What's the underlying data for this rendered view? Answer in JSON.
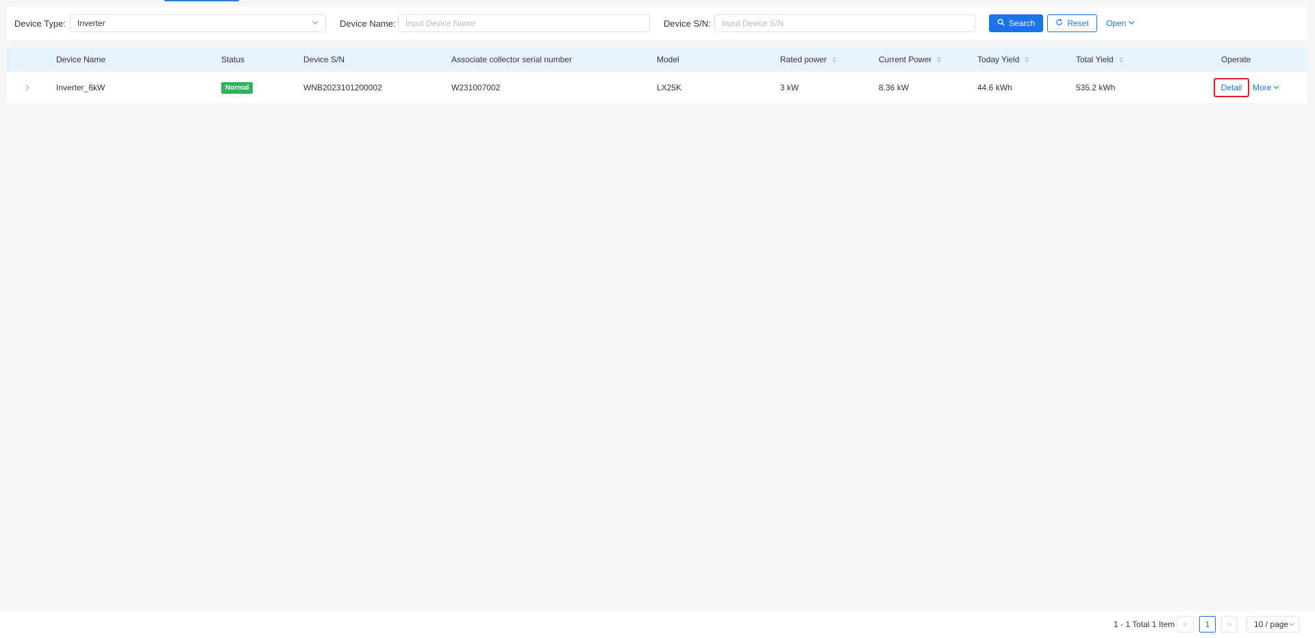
{
  "filters": {
    "device_type_label": "Device Type:",
    "device_type_value": "Inverter",
    "device_name_label": "Device Name:",
    "device_name_placeholder": "Input Device Name",
    "device_sn_label": "Device S/N:",
    "device_sn_placeholder": "Input Device S/N",
    "search_label": "Search",
    "reset_label": "Reset",
    "open_label": "Open"
  },
  "table": {
    "headers": {
      "device_name": "Device Name",
      "status": "Status",
      "device_sn": "Device S/N",
      "collector_sn": "Associate collector serial number",
      "model": "Model",
      "rated_power": "Rated power",
      "current_power": "Current Power",
      "today_yield": "Today Yield",
      "total_yield": "Total Yield",
      "operate": "Operate"
    },
    "rows": [
      {
        "device_name": "Inverter_6kW",
        "status": "Normal",
        "device_sn": "WNB2023101200002",
        "collector_sn": "W231007002",
        "model": "LX25K",
        "rated_power": "3 kW",
        "current_power": "8.36 kW",
        "today_yield": "44.6 kWh",
        "total_yield": "535.2 kWh",
        "detail_label": "Detail",
        "more_label": "More"
      }
    ]
  },
  "pagination": {
    "summary": "1 - 1 Total 1 Item",
    "prev": "<",
    "current_page": "1",
    "next": ">",
    "page_size": "10 / page"
  },
  "colors": {
    "accent": "#1a73e8",
    "status_normal": "#2db35a",
    "highlight_border": "#e02020",
    "table_header_bg": "#e6f2fd"
  }
}
